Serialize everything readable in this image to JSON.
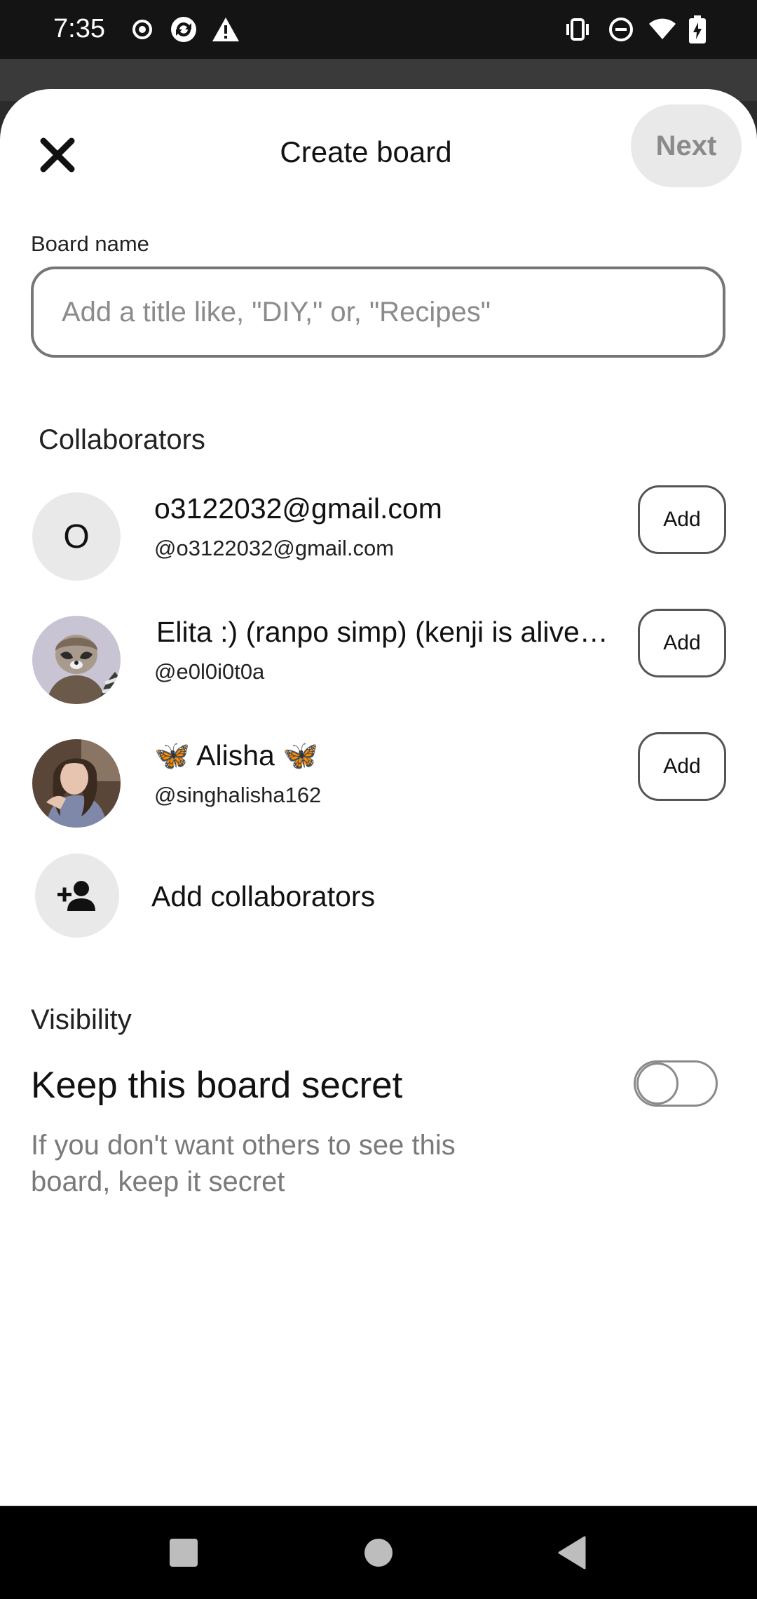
{
  "status_bar": {
    "time": "7:35",
    "left_icons": [
      "record-icon",
      "sync-icon",
      "warning-icon"
    ],
    "right_icons": [
      "vibrate-icon",
      "do-not-disturb-icon",
      "wifi-icon",
      "battery-charging-icon"
    ]
  },
  "header": {
    "title": "Create board",
    "next_label": "Next",
    "close_icon": "close-icon"
  },
  "board_name": {
    "label": "Board name",
    "value": "",
    "placeholder": "Add a title like, \"DIY,\" or, \"Recipes\""
  },
  "collaborators": {
    "title": "Collaborators",
    "items": [
      {
        "avatar_letter": "O",
        "name": "o3122032@gmail.com",
        "handle": "@o3122032@gmail.com",
        "add_label": "Add"
      },
      {
        "avatar_letter": "",
        "name": "Elita :) (ranpo simp) (kenji is alive…",
        "handle": "@e0l0i0t0a",
        "add_label": "Add"
      },
      {
        "avatar_letter": "",
        "name": "🦋 Alisha 🦋",
        "handle": "@singhalisha162",
        "add_label": "Add"
      }
    ],
    "add_more_label": "Add collaborators"
  },
  "visibility": {
    "label": "Visibility",
    "title": "Keep this board secret",
    "description": "If you don't want others to see this board, keep it secret",
    "secret_enabled": false
  },
  "nav_bar": {
    "icons": [
      "recents-icon",
      "home-icon",
      "back-icon"
    ]
  },
  "colors": {
    "next_bg": "#e9e9e9",
    "next_text": "#8a8a8a",
    "input_border": "#767676",
    "avatar_bg": "#e9e9e9"
  }
}
